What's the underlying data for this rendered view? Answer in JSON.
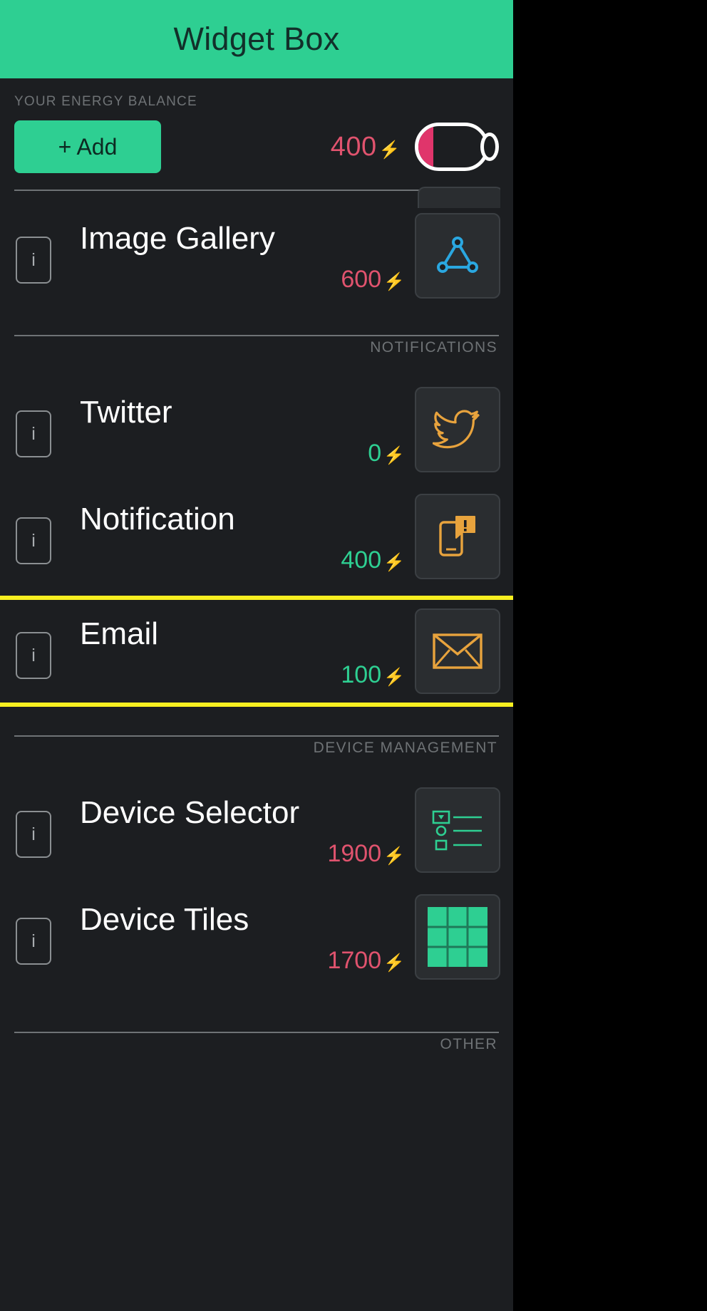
{
  "app": {
    "title": "Widget Box",
    "header_bg": "#2ecf92",
    "page_bg": "#1c1e21"
  },
  "energy": {
    "section_label": "YOUR ENERGY BALANCE",
    "add_label": "+ Add",
    "amount": "400",
    "bolt": "⚡",
    "amount_color": "#e0536e",
    "battery_level_percent": 22
  },
  "info_glyph": "i",
  "groups": [
    {
      "header": "",
      "items": [
        {
          "name": "Image Gallery",
          "cost": "600",
          "cost_color": "#e0536e",
          "icon": "image-gallery-icon",
          "icon_color": "#2aa7e0",
          "highlighted": false
        }
      ]
    },
    {
      "header": "NOTIFICATIONS",
      "items": [
        {
          "name": "Twitter",
          "cost": "0",
          "cost_color": "#2ecf92",
          "icon": "twitter-bird-icon",
          "icon_color": "#e8a33d",
          "highlighted": false
        },
        {
          "name": "Notification",
          "cost": "400",
          "cost_color": "#2ecf92",
          "icon": "notification-phone-icon",
          "icon_color": "#e8a33d",
          "highlighted": false
        },
        {
          "name": "Email",
          "cost": "100",
          "cost_color": "#2ecf92",
          "icon": "envelope-icon",
          "icon_color": "#e8a33d",
          "highlighted": true
        }
      ]
    },
    {
      "header": "DEVICE MANAGEMENT",
      "items": [
        {
          "name": "Device Selector",
          "cost": "1900",
          "cost_color": "#e0536e",
          "icon": "device-selector-list-icon",
          "icon_color": "#2ecf92",
          "highlighted": false
        },
        {
          "name": "Device Tiles",
          "cost": "1700",
          "cost_color": "#e0536e",
          "icon": "device-tiles-grid-icon",
          "icon_color": "#2ecf92",
          "highlighted": false
        }
      ]
    },
    {
      "header": "OTHER",
      "items": []
    }
  ],
  "highlight_color": "#f7ef20"
}
